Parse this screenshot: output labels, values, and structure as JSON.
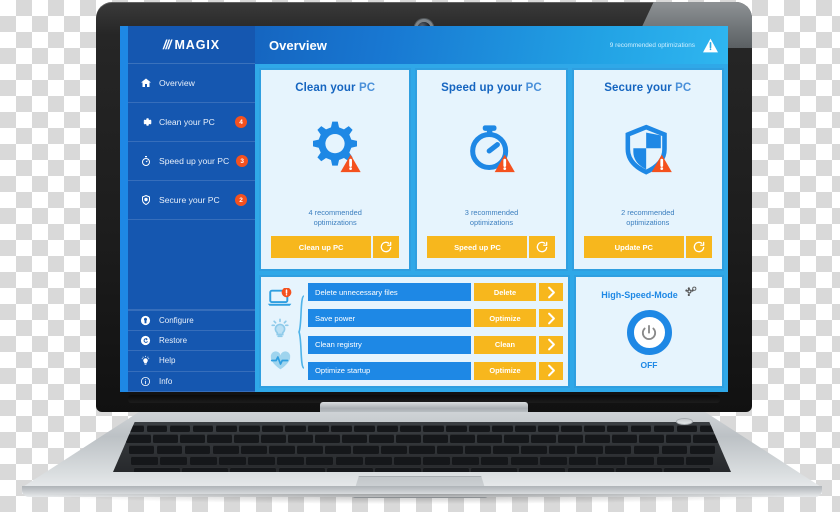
{
  "brand": {
    "slashes": "///",
    "name": "MAGIX"
  },
  "header": {
    "title": "Overview",
    "status": "9 recommended optimizations",
    "warning_icon": "warning-triangle-icon"
  },
  "sidebar": {
    "items": [
      {
        "label": "Overview",
        "icon": "home-icon",
        "badge": ""
      },
      {
        "label": "Clean your PC",
        "icon": "gear-icon",
        "badge": "4"
      },
      {
        "label": "Speed up your PC",
        "icon": "stopwatch-icon",
        "badge": "3"
      },
      {
        "label": "Secure your PC",
        "icon": "shield-icon",
        "badge": "2"
      }
    ],
    "bottom_items": [
      {
        "label": "Configure",
        "icon": "configure-icon"
      },
      {
        "label": "Restore",
        "icon": "restore-icon"
      },
      {
        "label": "Help",
        "icon": "lightbulb-icon"
      },
      {
        "label": "Info",
        "icon": "info-icon"
      }
    ]
  },
  "cards": [
    {
      "title_strong": "Clean your",
      "title_light": "PC",
      "icon": "gear-alert-icon",
      "rec_line1": "4 recommended",
      "rec_line2": "optimizations",
      "button": "Clean up PC",
      "refresh_icon": "refresh-icon"
    },
    {
      "title_strong": "Speed up your",
      "title_light": "PC",
      "icon": "stopwatch-alert-icon",
      "rec_line1": "3 recommended",
      "rec_line2": "optimizations",
      "button": "Speed up PC",
      "refresh_icon": "refresh-icon"
    },
    {
      "title_strong": "Secure your",
      "title_light": "PC",
      "icon": "shield-alert-icon",
      "rec_line1": "2 recommended",
      "rec_line2": "optimizations",
      "button": "Update PC",
      "refresh_icon": "refresh-icon"
    }
  ],
  "tasks": {
    "icons": [
      "laptop-alert-icon",
      "lightbulb-icon",
      "heart-pulse-icon"
    ],
    "rows": [
      {
        "name": "Delete unnecessary files",
        "action": "Delete",
        "go_icon": "chevron-right-icon"
      },
      {
        "name": "Save power",
        "action": "Optimize",
        "go_icon": "chevron-right-icon"
      },
      {
        "name": "Clean registry",
        "action": "Clean",
        "go_icon": "chevron-right-icon"
      },
      {
        "name": "Optimize startup",
        "action": "Optimize",
        "go_icon": "chevron-right-icon"
      }
    ]
  },
  "high_speed_mode": {
    "title": "High-Speed-Mode",
    "settings_icon": "gear-settings-icon",
    "power_icon": "power-icon",
    "state": "OFF"
  },
  "colors": {
    "brand_blue": "#1565C0",
    "accent_blue": "#1E88E5",
    "cyan": "#2FA8E8",
    "amber": "#F7B71D",
    "badge_red": "#F4511E",
    "card_bg": "#E6F4FD"
  }
}
